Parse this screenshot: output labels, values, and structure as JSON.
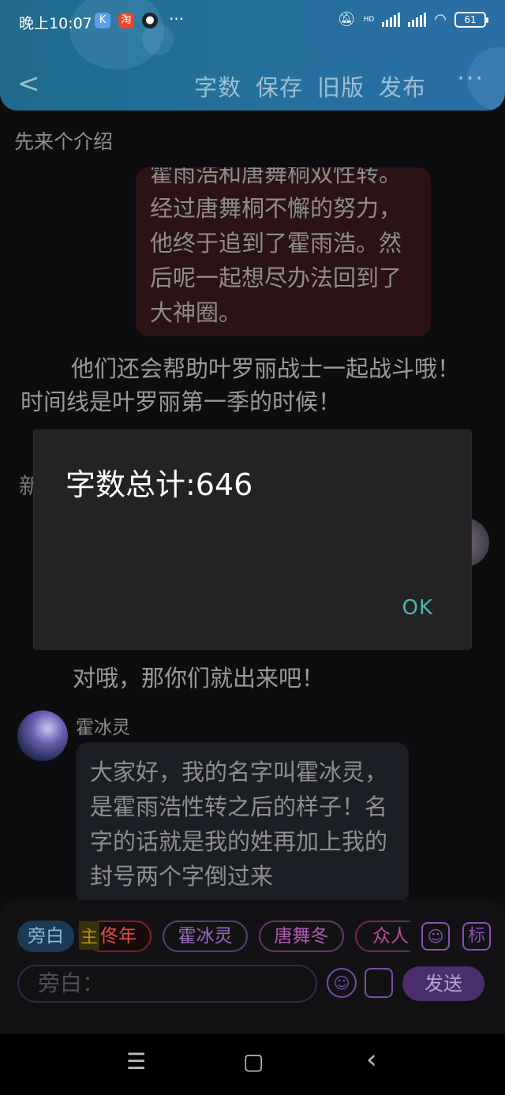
{
  "status_bar": {
    "time": "晚上10:07",
    "app_icons": [
      "K",
      "淘",
      "●"
    ],
    "more": "···",
    "signal_label": "HD",
    "battery": "61"
  },
  "header": {
    "back_icon": "chevron-left",
    "actions": [
      "字数",
      "保存",
      "旧版",
      "发布"
    ],
    "more": "···"
  },
  "content": {
    "section_title": "先来个介绍",
    "pink_bubble_text": "霍雨浩和唐舞桐双性转。经过唐舞桐不懈的努力，他终于追到了霍雨浩。然后呢一起想尽办法回到了大神圈。",
    "narration_1": "他们还会帮助叶罗丽战士一起战斗哦！时间线是叶罗丽第一季的时候！",
    "hidden_char": "新",
    "narration_2": "对哦，那你们就出来吧！",
    "speaker_name": "霍冰灵",
    "speaker_text": "大家好，我的名字叫霍冰灵，是霍雨浩性转之后的样子！名字的话就是我的姓再加上我的封号两个字倒过来"
  },
  "dialog": {
    "message": "字数总计:646",
    "ok_label": "OK"
  },
  "input_panel": {
    "selected_chip": "旁白",
    "role_tag": "主",
    "chips": [
      "佟年",
      "霍冰灵",
      "唐舞冬",
      "众人"
    ],
    "icon_person": "person-icon",
    "icon_tag_label": "标",
    "placeholder": "旁白：",
    "send_label": "发送"
  },
  "system_nav": {
    "menu": "☰",
    "home": "▢",
    "back": "‹"
  }
}
